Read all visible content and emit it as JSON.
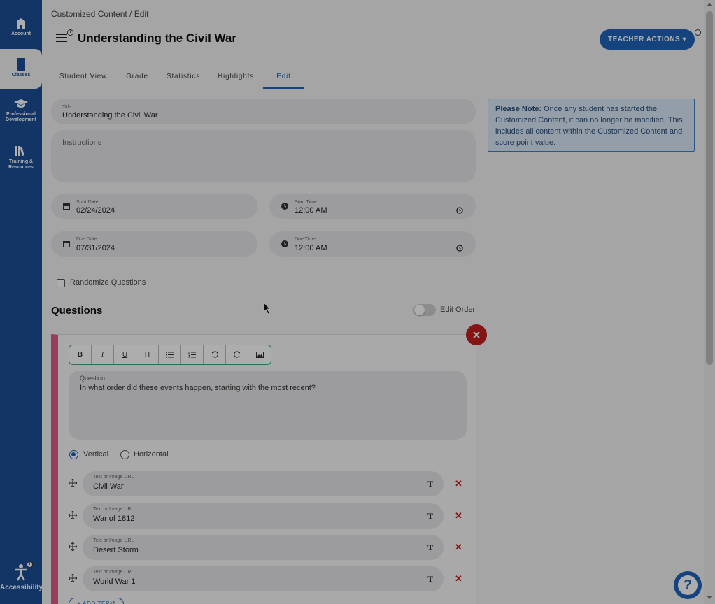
{
  "nav": {
    "items": [
      {
        "label_lines": [
          "Account"
        ],
        "icon": "school-icon"
      },
      {
        "label_lines": [
          "Classes"
        ],
        "icon": "book-icon",
        "active": true
      },
      {
        "label_lines": [
          "Professional",
          "Development"
        ],
        "icon": "graduation-cap-icon"
      },
      {
        "label_lines": [
          "Training &",
          "Resources"
        ],
        "icon": "library-icon"
      }
    ],
    "accessibility_label": "Accessibility"
  },
  "breadcrumb": "Customized Content / Edit",
  "page_title": "Understanding the Civil War",
  "teacher_actions": "TEACHER ACTIONS ▾",
  "tabs": [
    "Student View",
    "Grade",
    "Statistics",
    "Highlights",
    "Edit"
  ],
  "active_tab": "Edit",
  "form": {
    "title_label": "Title",
    "title_value": "Understanding the Civil War",
    "instructions_placeholder": "Instructions",
    "start_date_label": "Start Date",
    "start_date": "02/24/2024",
    "start_time_label": "Start Time",
    "start_time": "12:00 AM",
    "due_date_label": "Due Date",
    "due_date": "07/31/2024",
    "due_time_label": "Due Time",
    "due_time": "12:00 AM",
    "randomize_label": "Randomize Questions"
  },
  "note": {
    "bold": "Please Note:",
    "text": " Once any student has started the Customized Content, it can no longer be modified. This includes all content within the Customized Content and score point value."
  },
  "questions": {
    "heading": "Questions",
    "edit_order_label": "Edit Order",
    "toolbar": [
      "B",
      "I",
      "U",
      "H",
      "bulleted-list",
      "numbered-list",
      "undo",
      "redo",
      "image"
    ],
    "question_label": "Question",
    "question_text": "In what order did these events happen, starting with the most recent?",
    "orientation_vertical": "Vertical",
    "orientation_horizontal": "Horizontal",
    "term_label": "Text or Image URL",
    "term_type_glyph": "T",
    "terms": [
      "Civil War",
      "War of 1812",
      "Desert Storm",
      "World War 1"
    ],
    "add_term": "+ ADD TERM"
  },
  "colors": {
    "nav_bg": "#1b4f95",
    "accent": "#1e63b8",
    "question_bar": "#e35b87",
    "delete": "#c41e1e"
  }
}
